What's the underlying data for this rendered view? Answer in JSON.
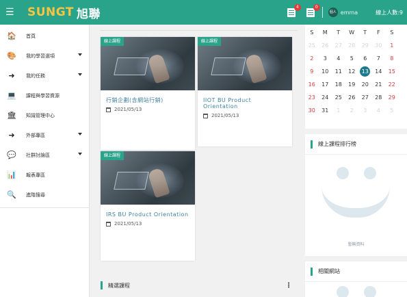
{
  "topbar": {
    "logo_latin": "SUNGT",
    "logo_cjk": "旭聯",
    "badge_1": "4",
    "badge_2": "0",
    "avatar_text": "個人",
    "username": "emma",
    "online_label": "線上人數:9"
  },
  "sidebar": {
    "items": [
      {
        "icon": "home-icon",
        "glyph": "🏠",
        "label": "首頁",
        "has_caret": false
      },
      {
        "icon": "palette-icon",
        "glyph": "🎨",
        "label": "我的學習選項",
        "has_caret": true
      },
      {
        "icon": "sign-in-icon",
        "glyph": "➜",
        "label": "我的任務",
        "has_caret": true
      },
      {
        "icon": "laptop-icon",
        "glyph": "💻",
        "label": "課程與學習資源",
        "has_caret": false
      },
      {
        "icon": "institution-icon",
        "glyph": "🏛",
        "label": "知識管理中心",
        "has_caret": false
      },
      {
        "icon": "sign-in-icon",
        "glyph": "➜",
        "label": "外部專區",
        "has_caret": true
      },
      {
        "icon": "comments-icon",
        "glyph": "💬",
        "label": "社群討論區",
        "has_caret": true
      },
      {
        "icon": "bar-chart-icon",
        "glyph": "📊",
        "label": "報表專區",
        "has_caret": false
      },
      {
        "icon": "search-icon",
        "glyph": "🔍",
        "label": "進階搜尋",
        "has_caret": false
      }
    ]
  },
  "main": {
    "cards": [
      {
        "tag": "線上課程",
        "title": "行銷企劃(含網站行銷)",
        "date": "2021/05/13"
      },
      {
        "tag": "線上課程",
        "title": "IIOT BU Product Orientation",
        "date": "2021/05/13"
      },
      {
        "tag": "線上課程",
        "title": "IRS BU Product Orientation",
        "date": "2021/05/13"
      }
    ],
    "section_title": "精選課程",
    "section_menu": "⋮"
  },
  "calendar": {
    "weekdays": [
      "S",
      "M",
      "T",
      "W",
      "T",
      "F",
      "S"
    ],
    "weeks": [
      [
        {
          "d": "25",
          "s": "muted"
        },
        {
          "d": "26",
          "s": "muted"
        },
        {
          "d": "27",
          "s": "muted"
        },
        {
          "d": "28",
          "s": "muted"
        },
        {
          "d": "29",
          "s": "muted"
        },
        {
          "d": "30",
          "s": "muted"
        },
        {
          "d": "1",
          "s": "red"
        }
      ],
      [
        {
          "d": "2",
          "s": "red"
        },
        {
          "d": "3",
          "s": ""
        },
        {
          "d": "4",
          "s": ""
        },
        {
          "d": "5",
          "s": ""
        },
        {
          "d": "6",
          "s": ""
        },
        {
          "d": "7",
          "s": ""
        },
        {
          "d": "8",
          "s": "red"
        }
      ],
      [
        {
          "d": "9",
          "s": "red"
        },
        {
          "d": "10",
          "s": ""
        },
        {
          "d": "11",
          "s": ""
        },
        {
          "d": "12",
          "s": ""
        },
        {
          "d": "13",
          "s": "today"
        },
        {
          "d": "14",
          "s": ""
        },
        {
          "d": "15",
          "s": "red"
        }
      ],
      [
        {
          "d": "16",
          "s": "red"
        },
        {
          "d": "17",
          "s": ""
        },
        {
          "d": "18",
          "s": ""
        },
        {
          "d": "19",
          "s": ""
        },
        {
          "d": "20",
          "s": ""
        },
        {
          "d": "21",
          "s": ""
        },
        {
          "d": "22",
          "s": "red"
        }
      ],
      [
        {
          "d": "23",
          "s": "red"
        },
        {
          "d": "24",
          "s": ""
        },
        {
          "d": "25",
          "s": ""
        },
        {
          "d": "26",
          "s": ""
        },
        {
          "d": "27",
          "s": ""
        },
        {
          "d": "28",
          "s": ""
        },
        {
          "d": "29",
          "s": "red"
        }
      ],
      [
        {
          "d": "30",
          "s": "red"
        },
        {
          "d": "31",
          "s": ""
        },
        {
          "d": "1",
          "s": "muted"
        },
        {
          "d": "2",
          "s": "muted"
        },
        {
          "d": "3",
          "s": "muted"
        },
        {
          "d": "4",
          "s": "muted"
        },
        {
          "d": "5",
          "s": "muted"
        }
      ]
    ]
  },
  "ranking": {
    "title": "線上課程排行榜",
    "empty_text": "暫無資料"
  },
  "links": {
    "title": "相關網站"
  },
  "colors": {
    "brand": "#2aa38b",
    "logo_yellow": "#f6c542",
    "title_blue": "#3c7f9e",
    "weekend_red": "#d73a3a",
    "today": "#1d7a8c"
  }
}
